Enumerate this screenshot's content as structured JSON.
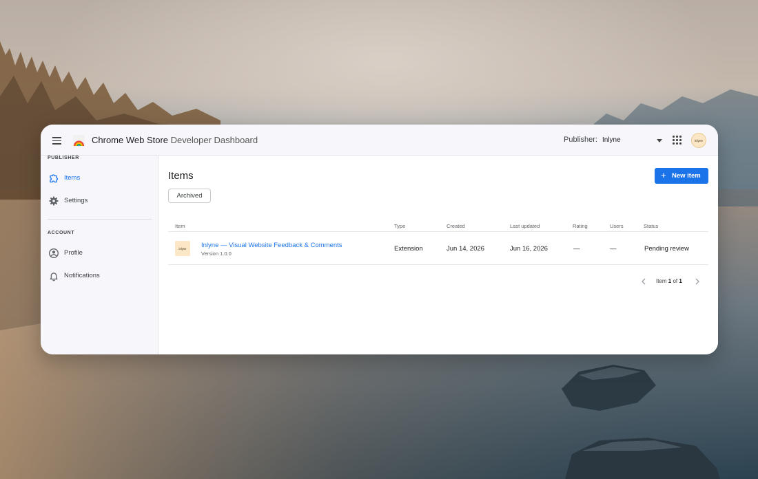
{
  "app": {
    "title_main": "Chrome Web Store",
    "title_sub": "Developer Dashboard"
  },
  "topbar": {
    "publisher_label": "Publisher:",
    "publisher_value": "Inlyne",
    "avatar_text": "inlyne"
  },
  "sidebar": {
    "publisher_section": "PUBLISHER",
    "account_section": "ACCOUNT",
    "items": [
      {
        "label": "Items",
        "icon": "puzzle-icon",
        "active": true
      },
      {
        "label": "Settings",
        "icon": "gear-icon",
        "active": false
      },
      {
        "label": "Profile",
        "icon": "account-circle-icon",
        "active": false
      },
      {
        "label": "Notifications",
        "icon": "bell-icon",
        "active": false
      }
    ]
  },
  "main": {
    "title": "Items",
    "new_item_label": "New item",
    "archived_label": "Archived",
    "columns": [
      "Item",
      "Type",
      "Created",
      "Last updated",
      "Rating",
      "Users",
      "Status"
    ],
    "rows": [
      {
        "thumb_text": "inlyne",
        "name": "Inlyne — Visual Website Feedback & Comments",
        "version": "Version 1.0.0",
        "type": "Extension",
        "created": "Jun 14, 2026",
        "updated": "Jun 16, 2026",
        "rating": "—",
        "users": "—",
        "status": "Pending review"
      }
    ],
    "pager": {
      "prefix": "Item",
      "current": "1",
      "of": "of",
      "total": "1"
    }
  },
  "colors": {
    "accent": "#1a73e8",
    "avatar_bg": "#fbe7c6"
  }
}
